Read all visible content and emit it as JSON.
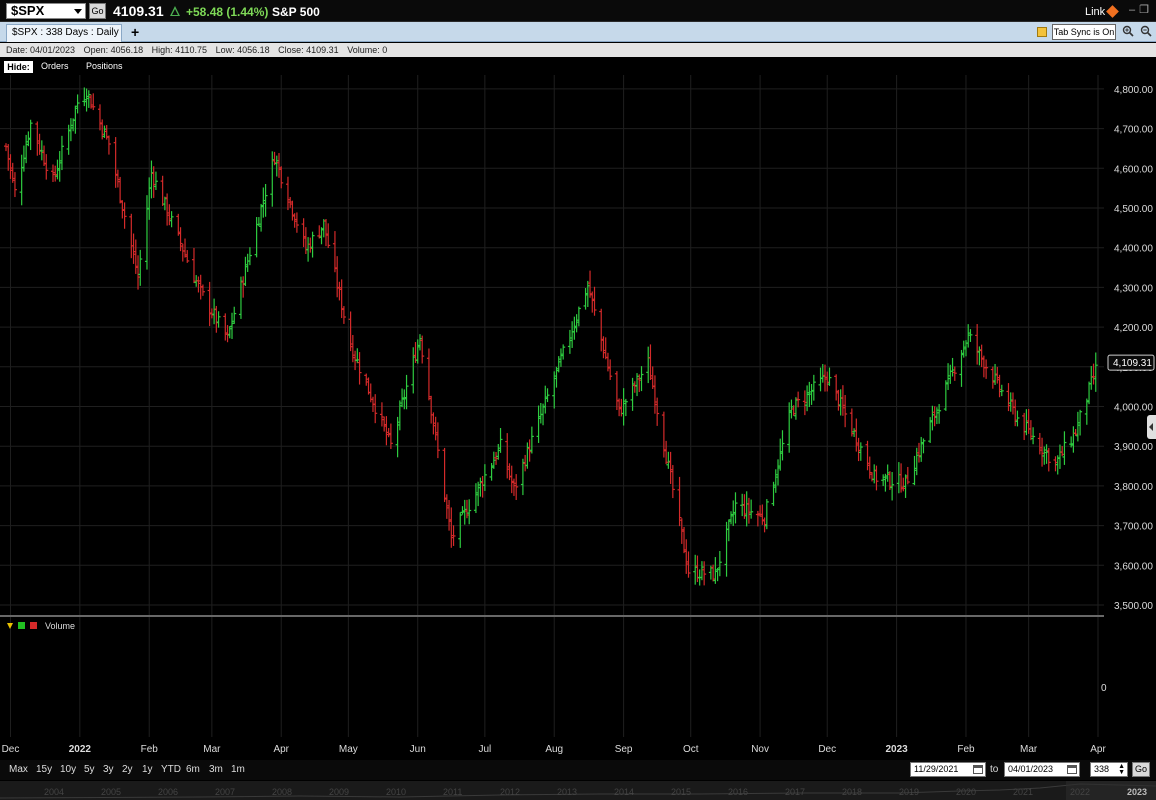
{
  "header": {
    "symbol": "$SPX",
    "go_label": "Go",
    "last_price": "4109.31",
    "change": "+58.48 (1.44%)",
    "instrument_name": "S&P 500",
    "link_label": "Link",
    "minimize": "–",
    "restore": "❐",
    "close": "✕"
  },
  "tabs": {
    "active_tab": "$SPX : 338  Days : Daily",
    "add_label": "+",
    "sync_label": "Tab Sync is On"
  },
  "info_bar": {
    "date": "Date: 04/01/2023",
    "open": "Open: 4056.18",
    "high": "High: 4110.75",
    "low": "Low: 4056.18",
    "close": "Close: 4109.31",
    "volume": "Volume: 0"
  },
  "panel_toggles": {
    "hide": "Hide:",
    "orders": "Orders",
    "positions": "Positions"
  },
  "volume_panel": {
    "title": "Volume",
    "zero_label": "0"
  },
  "colors": {
    "up": "#2ecc40",
    "down": "#d42a2a",
    "grid": "#1f1f1f",
    "background": "#000000"
  },
  "chart_data": {
    "type": "ohlc",
    "title": "$SPX : 338  Days : Daily",
    "xlabel": "",
    "ylabel": "",
    "ylim": [
      3470,
      4840
    ],
    "y_ticks": [
      "3,500.00",
      "3,600.00",
      "3,700.00",
      "3,800.00",
      "3,900.00",
      "4,000.00",
      "4,100.00",
      "4,200.00",
      "4,300.00",
      "4,400.00",
      "4,500.00",
      "4,600.00",
      "4,700.00",
      "4,800.00"
    ],
    "y_tick_values": [
      3500,
      3600,
      3700,
      3800,
      3900,
      4000,
      4100,
      4200,
      4300,
      4400,
      4500,
      4600,
      4700,
      4800
    ],
    "x_tick_labels": [
      "Dec",
      "2022",
      "Feb",
      "Mar",
      "Apr",
      "May",
      "Jun",
      "Jul",
      "Aug",
      "Sep",
      "Oct",
      "Nov",
      "Dec",
      "2023",
      "Feb",
      "Mar",
      "Apr"
    ],
    "x_tick_dates": [
      "2021-12-01",
      "2022-01-01",
      "2022-02-01",
      "2022-03-01",
      "2022-04-01",
      "2022-05-01",
      "2022-06-01",
      "2022-07-01",
      "2022-08-01",
      "2022-09-01",
      "2022-10-01",
      "2022-11-01",
      "2022-12-01",
      "2023-01-01",
      "2023-02-01",
      "2023-03-01",
      "2023-04-01"
    ],
    "date_range": [
      "2021-11-29",
      "2023-04-01"
    ],
    "grid": true,
    "last_price_label": "4,109.31",
    "last_price_value": 4109.31,
    "close_path": [
      [
        "2021-11-29",
        4655
      ],
      [
        "2021-12-03",
        4540
      ],
      [
        "2021-12-10",
        4712
      ],
      [
        "2021-12-20",
        4568
      ],
      [
        "2021-12-31",
        4766
      ],
      [
        "2022-01-04",
        4793
      ],
      [
        "2022-01-14",
        4662
      ],
      [
        "2022-01-27",
        4326
      ],
      [
        "2022-02-02",
        4589
      ],
      [
        "2022-02-24",
        4288
      ],
      [
        "2022-03-08",
        4170
      ],
      [
        "2022-03-29",
        4631
      ],
      [
        "2022-04-12",
        4397
      ],
      [
        "2022-04-20",
        4459
      ],
      [
        "2022-05-02",
        4155
      ],
      [
        "2022-05-20",
        3901
      ],
      [
        "2022-06-02",
        4176
      ],
      [
        "2022-06-16",
        3667
      ],
      [
        "2022-07-08",
        3900
      ],
      [
        "2022-07-14",
        3790
      ],
      [
        "2022-08-16",
        4305
      ],
      [
        "2022-08-30",
        3986
      ],
      [
        "2022-09-12",
        4110
      ],
      [
        "2022-09-30",
        3586
      ],
      [
        "2022-10-12",
        3577
      ],
      [
        "2022-10-21",
        3752
      ],
      [
        "2022-11-03",
        3720
      ],
      [
        "2022-11-15",
        3992
      ],
      [
        "2022-12-01",
        4076
      ],
      [
        "2022-12-22",
        3822
      ],
      [
        "2023-01-05",
        3808
      ],
      [
        "2023-02-02",
        4179
      ],
      [
        "2023-02-24",
        3970
      ],
      [
        "2023-03-13",
        3855
      ],
      [
        "2023-03-22",
        3937
      ],
      [
        "2023-04-01",
        4109.31
      ]
    ]
  },
  "range_buttons": [
    "Max",
    "15y",
    "10y",
    "5y",
    "3y",
    "2y",
    "1y",
    "YTD",
    "6m",
    "3m",
    "1m"
  ],
  "date_range_controls": {
    "start": "11/29/2021",
    "to_label": "to",
    "end": "04/01/2023",
    "days": "338",
    "go_label": "Go"
  },
  "navigator_years": [
    "2004",
    "2005",
    "2006",
    "2007",
    "2008",
    "2009",
    "2010",
    "2011",
    "2012",
    "2013",
    "2014",
    "2015",
    "2016",
    "2017",
    "2018",
    "2019",
    "2020",
    "2021",
    "2022",
    "2023"
  ]
}
